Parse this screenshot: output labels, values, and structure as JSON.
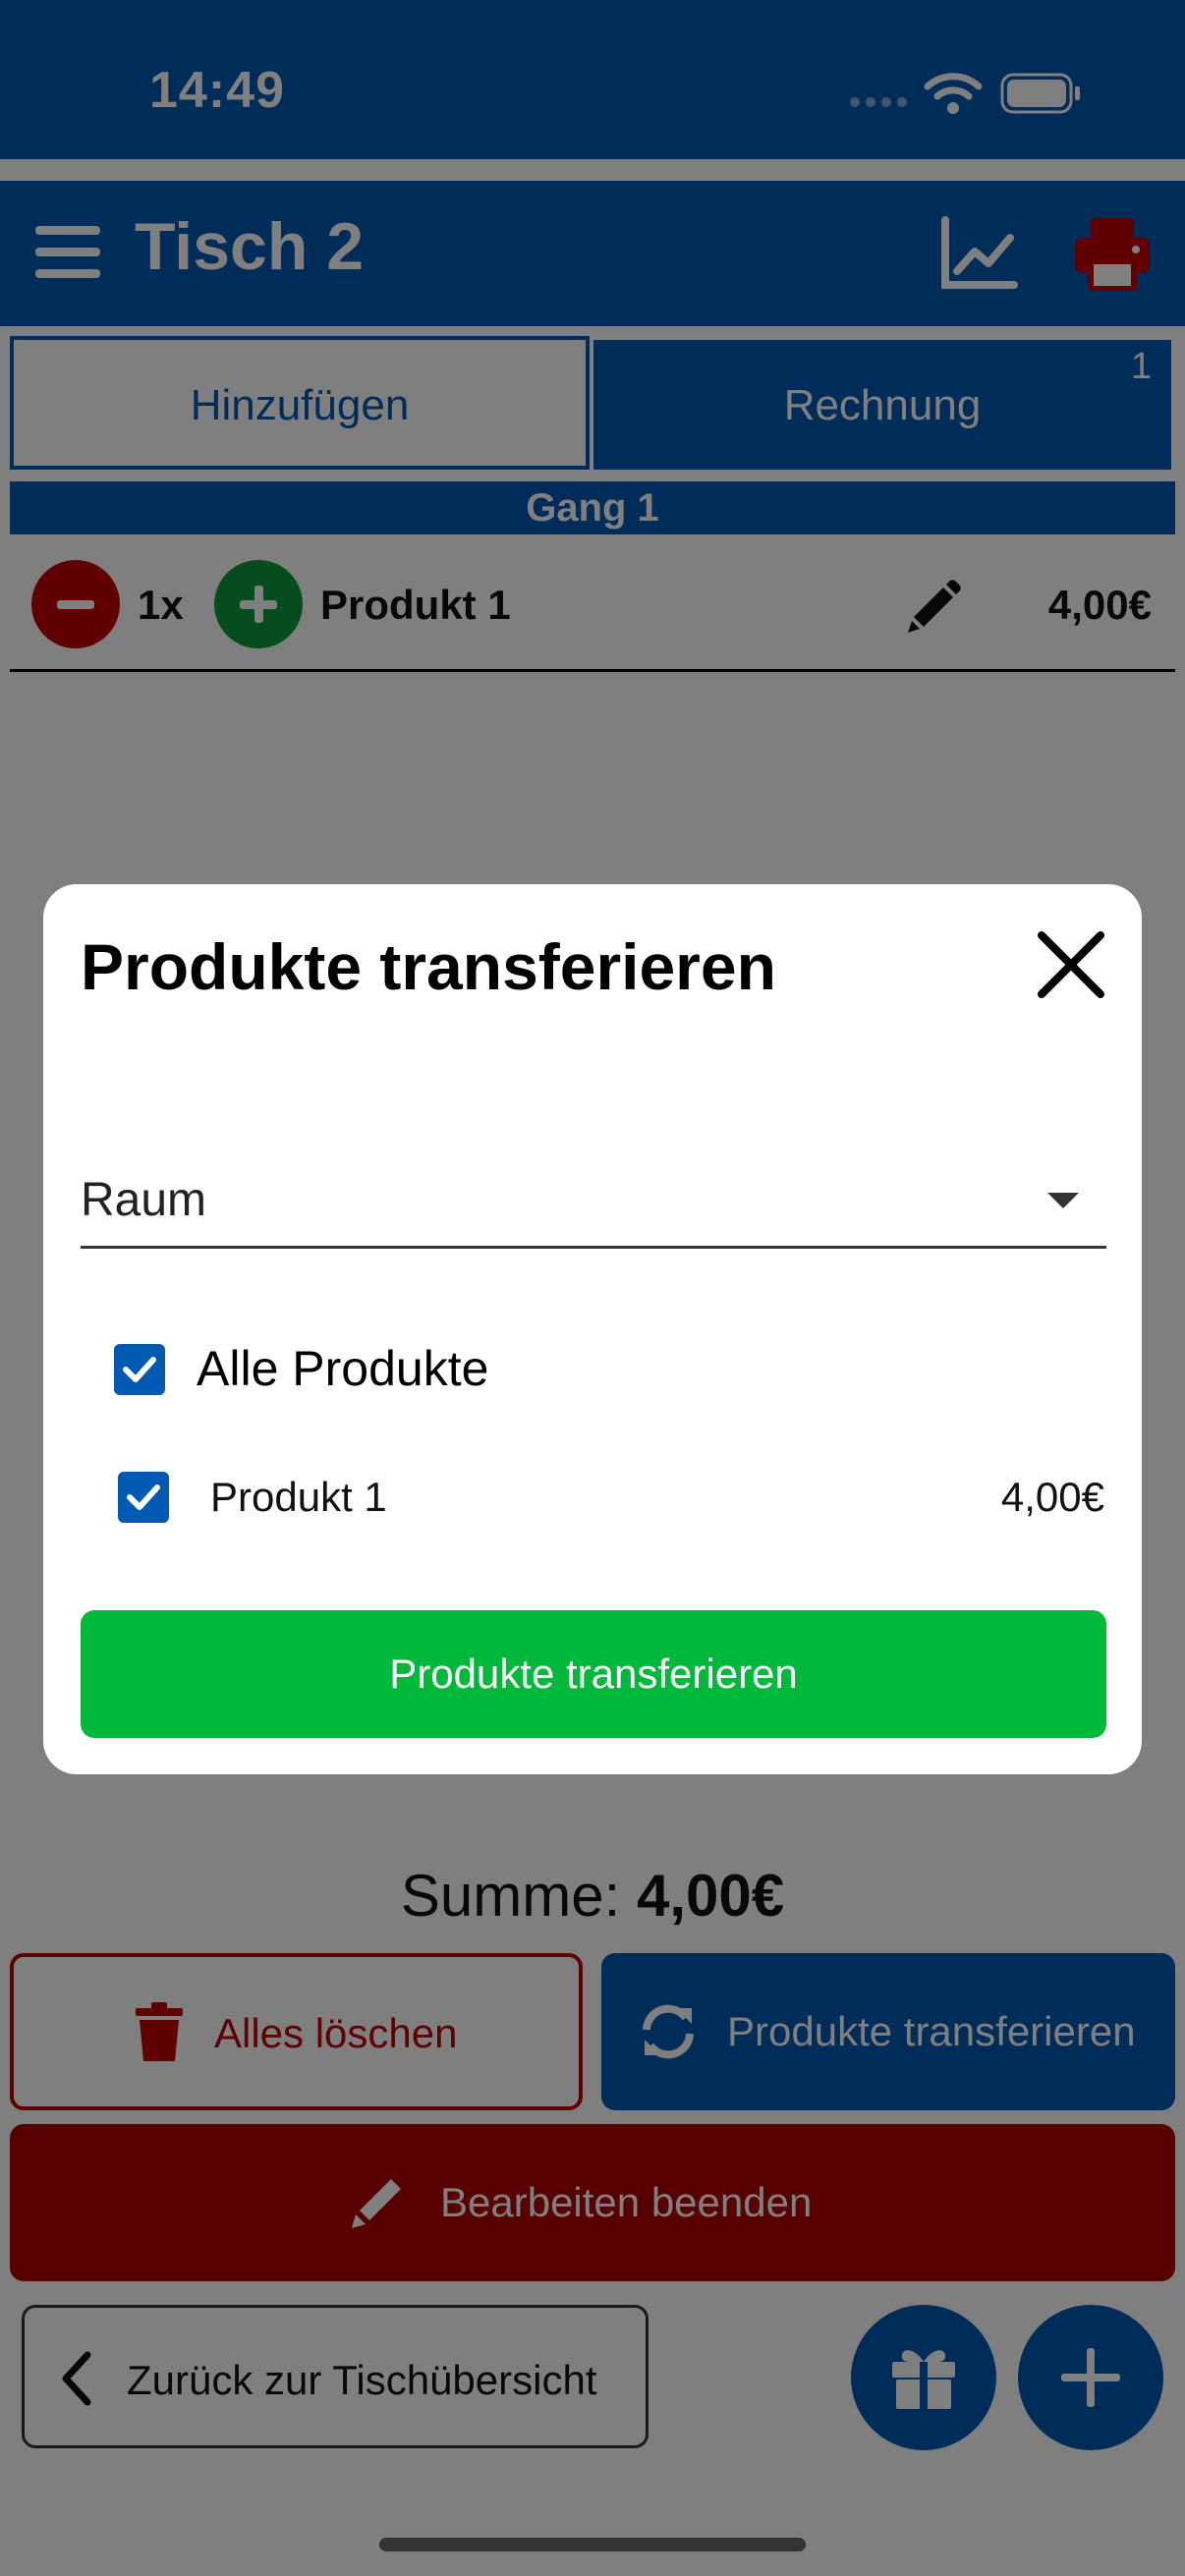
{
  "status_bar": {
    "time": "14:49"
  },
  "header": {
    "title": "Tisch 2",
    "menu_icon": "hamburger-icon",
    "stats_icon": "line-chart-icon",
    "print_icon": "printer-icon"
  },
  "tabs": [
    {
      "label": "Hinzufügen"
    },
    {
      "label": "Rechnung",
      "badge": "1"
    }
  ],
  "order": {
    "course_label": "Gang 1",
    "items": [
      {
        "qty": "1x",
        "name": "Produkt 1",
        "price": "4,00€"
      }
    ]
  },
  "footer": {
    "sum_label": "Summe:",
    "sum_value": "4,00€",
    "delete_all": "Alles löschen",
    "transfer": "Produkte transferieren",
    "finish_edit": "Bearbeiten beenden",
    "back": "Zurück zur Tischübersicht"
  },
  "modal": {
    "title": "Produkte transferieren",
    "select_label": "Raum",
    "all_products": "Alle Produkte",
    "products": [
      {
        "name": "Produkt 1",
        "price": "4,00€"
      }
    ],
    "confirm_label": "Produkte transferieren"
  },
  "colors": {
    "primary": "#0059b2",
    "danger": "#c00000",
    "success": "#00b83a",
    "add_green": "#0a9a3a"
  }
}
